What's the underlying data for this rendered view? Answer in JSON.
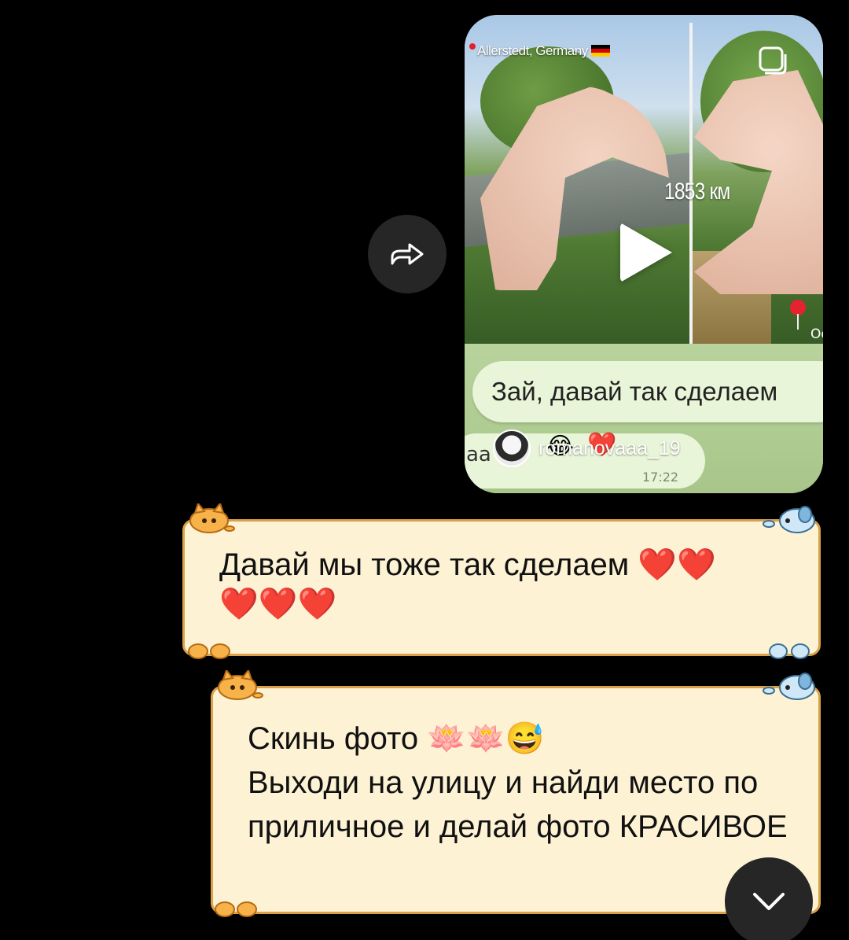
{
  "reel": {
    "location": "Allerstedt, Germany",
    "distance": "1853 км",
    "corner_text": "Od",
    "bubble_text": "Зай, давай так сделаем",
    "bubble2_text": "аа",
    "bubble2_time": "17:22",
    "username": "romanovaaa_19",
    "emojis": [
      "😂",
      "❤️"
    ]
  },
  "messages": [
    {
      "text": "Давай мы тоже так сделаем ❤️❤️\n❤️❤️❤️"
    },
    {
      "text": "Скинь фото 🪷🪷😅\nВыходи на улицу и найди место по приличное  и делай фото КРАСИВОЕ"
    }
  ],
  "icons": {
    "share": "share-arrow-icon",
    "scroll": "chevron-down-icon",
    "reel": "reels-icon"
  },
  "colors": {
    "background": "#000000",
    "bubble_fill": "#fdf2d4",
    "bubble_border": "#d9a24a",
    "button_fill": "#262626"
  }
}
